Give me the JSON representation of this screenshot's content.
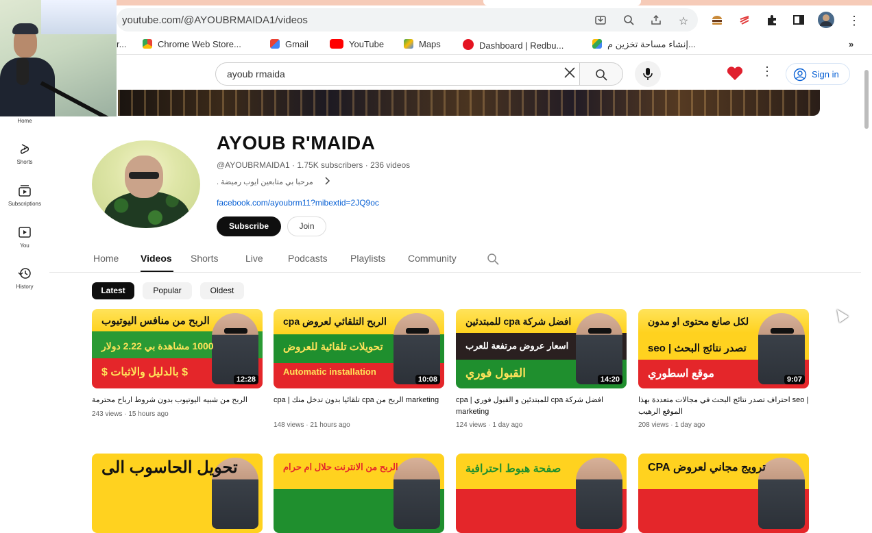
{
  "browser": {
    "url": "youtube.com/@AYOUBRMAIDA1/videos",
    "bookmarks": [
      {
        "label": "r...",
        "icon": "folder-icon"
      },
      {
        "label": "Chrome Web Store...",
        "icon": "chrome-web-store-icon"
      },
      {
        "label": "Gmail",
        "icon": "gmail-icon"
      },
      {
        "label": "YouTube",
        "icon": "youtube-icon"
      },
      {
        "label": "Maps",
        "icon": "maps-icon"
      },
      {
        "label": "Dashboard | Redbu...",
        "icon": "redbubble-icon"
      },
      {
        "label": "إنشاء مساحة تخزين م...",
        "icon": "drive-icon"
      }
    ],
    "more_bookmarks": "»"
  },
  "youtube": {
    "search_value": "ayoub rmaida",
    "sign_in": "Sign in"
  },
  "sidebar": [
    {
      "label": "Home",
      "icon": "home-icon"
    },
    {
      "label": "Shorts",
      "icon": "shorts-icon"
    },
    {
      "label": "Subscriptions",
      "icon": "subscriptions-icon"
    },
    {
      "label": "You",
      "icon": "you-icon"
    },
    {
      "label": "History",
      "icon": "history-icon"
    }
  ],
  "channel": {
    "name": "AYOUB R'MAIDA",
    "handle": "@AYOUBRMAIDA1",
    "subscribers": "1.75K subscribers",
    "videos_count": "236 videos",
    "description": "مرحبا بي متابعين ايوب رميضة .",
    "link": "facebook.com/ayoubrm11?mibextid=2JQ9oc",
    "subscribe": "Subscribe",
    "join": "Join"
  },
  "tabs": [
    "Home",
    "Videos",
    "Shorts",
    "Live",
    "Podcasts",
    "Playlists",
    "Community"
  ],
  "active_tab": "Videos",
  "chips": [
    "Latest",
    "Popular",
    "Oldest"
  ],
  "active_chip": "Latest",
  "videos": [
    {
      "thumb_lines": [
        "الربح من منافس اليوتيوب",
        "1000 مشاهدة بي 2.22 دولار",
        "$ بالدليل والاثبات $"
      ],
      "duration": "12:28",
      "title": "الربح من شبيه اليوتيوب بدون شروط ارباح محترمة",
      "views": "243 views",
      "age": "15 hours ago"
    },
    {
      "thumb_lines": [
        "الربح التلقائي لعروض cpa",
        "تحويلات تلقائية للعروض",
        "Automatic installation"
      ],
      "duration": "10:08",
      "title": "cpa | تلقائيا بدون تدخل منك cpa الربح من marketing",
      "views": "148 views",
      "age": "21 hours ago"
    },
    {
      "thumb_lines": [
        "افضل شركة cpa للمبتدئين",
        "اسعار عروض مرتفعة للعرب",
        "القبول فوري"
      ],
      "duration": "14:20",
      "title": "cpa | للمبتدئين و القبول فوري cpa افضل شركة marketing",
      "views": "124 views",
      "age": "1 day ago"
    },
    {
      "thumb_lines": [
        "لكل صانع محتوى او مدون",
        "تصدر نتائج البحث | seo",
        "موقع اسطوري"
      ],
      "duration": "9:07",
      "title": "احتراف تصدر نتائج البحث في مجالات متعددة بهذا seo | الموقع الرهيب",
      "views": "208 views",
      "age": "1 day ago"
    },
    {
      "thumb_lines": [
        "تحويل الحاسوب الى"
      ],
      "duration": "",
      "title": "",
      "views": "",
      "age": ""
    },
    {
      "thumb_lines": [
        "الربح من الانترنت حلال ام حرام"
      ],
      "duration": "",
      "title": "",
      "views": "",
      "age": ""
    },
    {
      "thumb_lines": [
        "صفحة هبوط احترافية"
      ],
      "duration": "",
      "title": "",
      "views": "",
      "age": ""
    },
    {
      "thumb_lines": [
        "ترويج مجاني لعروض CPA"
      ],
      "duration": "",
      "title": "",
      "views": "",
      "age": ""
    }
  ],
  "colors": {
    "youtube_red": "#ff0000",
    "link_blue": "#065fd4",
    "dark": "#0f0f0f",
    "secondary_text": "#606060",
    "thumb_red": "#e4262a",
    "thumb_yellow": "#ffd21f",
    "thumb_green": "#1f8f2e"
  }
}
